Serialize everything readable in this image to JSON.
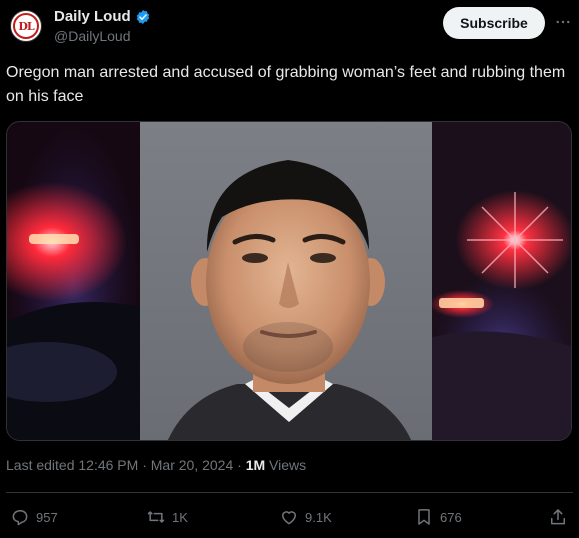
{
  "author": {
    "name": "Daily Loud",
    "handle": "@DailyLoud",
    "avatar_monogram": "DL"
  },
  "header": {
    "subscribe_label": "Subscribe",
    "more_icon": "more-horizontal-icon"
  },
  "tweet": {
    "text": "Oregon man arrested and accused of grabbing woman’s feet and rubbing them on his face"
  },
  "meta": {
    "edited_prefix": "Last edited 12:46 PM · Mar 20, 2024 · ",
    "views_count": "1M",
    "views_label": " Views"
  },
  "actions": {
    "replies": "957",
    "reposts": "1K",
    "likes": "9.1K",
    "bookmarks": "676"
  },
  "colors": {
    "verified": "#1d9bf0",
    "background": "#000000",
    "text": "#e7e9ea",
    "muted": "#71767b",
    "police_red": "#ff2a3a"
  }
}
